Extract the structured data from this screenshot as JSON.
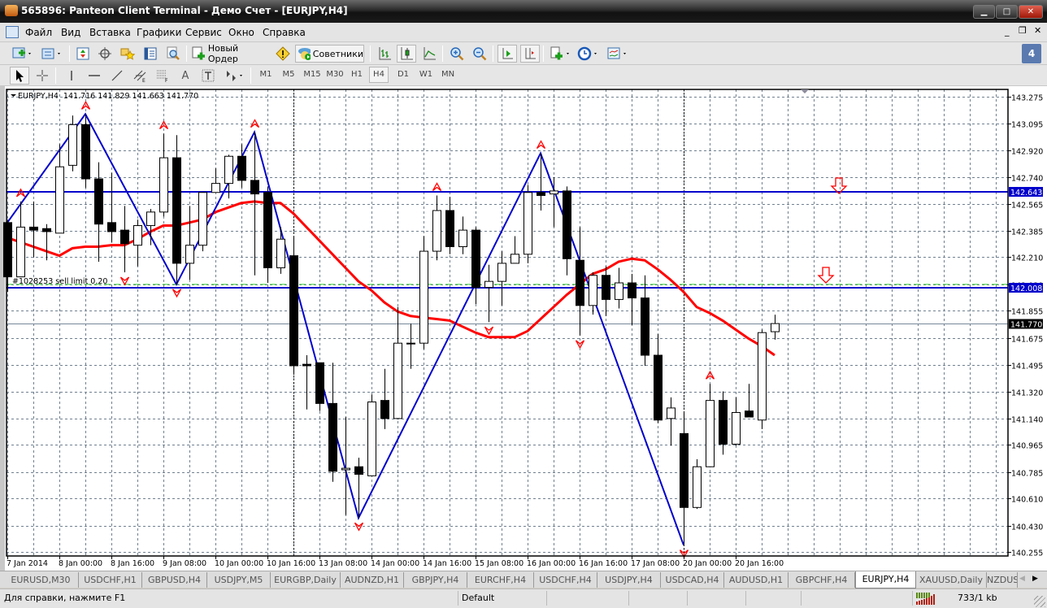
{
  "window": {
    "title": "565896: Panteon Client Terminal - Демо Счет - [EURJPY,H4]"
  },
  "menu": {
    "items": [
      "Файл",
      "Вид",
      "Вставка",
      "Графики",
      "Сервис",
      "Окно",
      "Справка"
    ]
  },
  "toolbar": {
    "new_order_label": "Новый Ордер",
    "experts_label": "Советники",
    "notifications_count": "4",
    "timeframes": [
      "M1",
      "M5",
      "M15",
      "M30",
      "H1",
      "H4",
      "D1",
      "W1",
      "MN"
    ],
    "active_timeframe": "H4"
  },
  "chart": {
    "header": "EURJPY,H4  141.716 141.829 141.663 141.770",
    "order_label": "#1028253 sell limit 0.20",
    "colors": {
      "bull": "#ffffff",
      "bear": "#000000",
      "ma": "#ff0000",
      "zigzag": "#0000cc",
      "level": "#0000cc",
      "order": "#33cc33",
      "grid": "#708090",
      "fractal": "#ff0000"
    }
  },
  "chart_data": {
    "type": "candlestick",
    "symbol": "EURJPY",
    "timeframe": "H4",
    "ylim": [
      140.255,
      143.275
    ],
    "price_ticks": [
      "143.275",
      "143.095",
      "142.920",
      "142.740",
      "142.565",
      "142.385",
      "142.210",
      "142.030",
      "141.855",
      "141.675",
      "141.495",
      "141.320",
      "141.140",
      "140.965",
      "140.785",
      "140.610",
      "140.430",
      "140.255"
    ],
    "time_labels": [
      {
        "bar": 0,
        "label": "7 Jan 2014"
      },
      {
        "bar": 4,
        "label": "8 Jan 00:00"
      },
      {
        "bar": 8,
        "label": "8 Jan 16:00"
      },
      {
        "bar": 12,
        "label": "9 Jan 08:00"
      },
      {
        "bar": 16,
        "label": "10 Jan 00:00"
      },
      {
        "bar": 20,
        "label": "10 Jan 16:00"
      },
      {
        "bar": 24,
        "label": "13 Jan 08:00"
      },
      {
        "bar": 28,
        "label": "14 Jan 00:00"
      },
      {
        "bar": 32,
        "label": "14 Jan 16:00"
      },
      {
        "bar": 36,
        "label": "15 Jan 08:00"
      },
      {
        "bar": 40,
        "label": "16 Jan 00:00"
      },
      {
        "bar": 44,
        "label": "16 Jan 16:00"
      },
      {
        "bar": 48,
        "label": "17 Jan 08:00"
      },
      {
        "bar": 52,
        "label": "20 Jan 00:00"
      },
      {
        "bar": 56,
        "label": "20 Jan 16:00"
      }
    ],
    "ohlc": [
      [
        142.44,
        142.46,
        141.98,
        142.08
      ],
      [
        142.08,
        142.58,
        142.08,
        142.41
      ],
      [
        142.41,
        142.58,
        142.21,
        142.39
      ],
      [
        142.4,
        142.43,
        142.19,
        142.38
      ],
      [
        142.37,
        142.96,
        142.37,
        142.81
      ],
      [
        142.82,
        143.15,
        142.78,
        143.09
      ],
      [
        143.09,
        143.16,
        142.67,
        142.73
      ],
      [
        142.73,
        142.84,
        142.18,
        142.43
      ],
      [
        142.44,
        142.77,
        142.31,
        142.38
      ],
      [
        142.39,
        142.55,
        142.11,
        142.3
      ],
      [
        142.29,
        142.46,
        142.15,
        142.42
      ],
      [
        142.42,
        142.53,
        142.29,
        142.51
      ],
      [
        142.51,
        143.03,
        142.48,
        142.87
      ],
      [
        142.87,
        143.02,
        142.03,
        142.17
      ],
      [
        142.17,
        142.55,
        142.06,
        142.29
      ],
      [
        142.29,
        142.64,
        142.25,
        142.64
      ],
      [
        142.64,
        142.8,
        142.64,
        142.7
      ],
      [
        142.7,
        142.89,
        142.6,
        142.88
      ],
      [
        142.88,
        142.96,
        142.67,
        142.72
      ],
      [
        142.72,
        143.04,
        142.09,
        142.63
      ],
      [
        142.64,
        142.68,
        142.04,
        142.14
      ],
      [
        142.14,
        142.41,
        142.1,
        142.33
      ],
      [
        142.22,
        142.35,
        141.43,
        141.49
      ],
      [
        141.5,
        141.56,
        141.2,
        141.49
      ],
      [
        141.51,
        141.51,
        141.19,
        141.24
      ],
      [
        141.24,
        141.51,
        140.72,
        140.79
      ],
      [
        140.8,
        141.15,
        140.5,
        140.81
      ],
      [
        140.82,
        140.88,
        140.48,
        140.77
      ],
      [
        140.76,
        141.3,
        140.76,
        141.25
      ],
      [
        141.26,
        141.47,
        141.07,
        141.14
      ],
      [
        141.14,
        141.88,
        141.14,
        141.64
      ],
      [
        141.64,
        141.77,
        141.47,
        141.64
      ],
      [
        141.64,
        142.35,
        141.6,
        142.25
      ],
      [
        142.25,
        142.62,
        142.19,
        142.52
      ],
      [
        142.52,
        142.61,
        142.23,
        142.28
      ],
      [
        142.28,
        142.48,
        142.23,
        142.39
      ],
      [
        142.39,
        142.41,
        141.9,
        142.01
      ],
      [
        142.01,
        142.16,
        141.78,
        142.05
      ],
      [
        142.05,
        142.25,
        141.89,
        142.17
      ],
      [
        142.17,
        142.35,
        142.17,
        142.23
      ],
      [
        142.23,
        142.69,
        142.17,
        142.64
      ],
      [
        142.64,
        142.9,
        142.52,
        142.62
      ],
      [
        142.63,
        142.74,
        142.41,
        142.65
      ],
      [
        142.65,
        142.68,
        142.09,
        142.2
      ],
      [
        142.19,
        142.41,
        141.69,
        141.89
      ],
      [
        141.89,
        142.11,
        141.83,
        142.09
      ],
      [
        142.09,
        142.15,
        141.82,
        141.93
      ],
      [
        141.93,
        142.14,
        141.87,
        142.04
      ],
      [
        142.04,
        142.1,
        141.76,
        141.94
      ],
      [
        141.94,
        142.09,
        141.49,
        141.56
      ],
      [
        141.56,
        141.7,
        141.11,
        141.13
      ],
      [
        141.14,
        141.28,
        140.96,
        141.21
      ],
      [
        141.04,
        141.18,
        140.3,
        140.55
      ],
      [
        140.55,
        140.87,
        140.54,
        140.82
      ],
      [
        140.82,
        141.37,
        140.82,
        141.26
      ],
      [
        141.26,
        141.32,
        140.9,
        140.97
      ],
      [
        140.97,
        141.28,
        140.96,
        141.18
      ],
      [
        141.19,
        141.37,
        141.15,
        141.15
      ],
      [
        141.13,
        141.73,
        141.07,
        141.71
      ],
      [
        141.716,
        141.829,
        141.663,
        141.77
      ]
    ],
    "ma": [
      142.34,
      142.31,
      142.28,
      142.25,
      142.22,
      142.27,
      142.28,
      142.28,
      142.29,
      142.29,
      142.33,
      142.38,
      142.42,
      142.42,
      142.44,
      142.46,
      142.51,
      142.54,
      142.57,
      142.58,
      142.57,
      142.57,
      142.5,
      142.41,
      142.32,
      142.23,
      142.14,
      142.05,
      141.99,
      141.91,
      141.85,
      141.82,
      141.81,
      141.8,
      141.79,
      141.75,
      141.71,
      141.68,
      141.68,
      141.68,
      141.72,
      141.8,
      141.88,
      141.96,
      142.03,
      142.1,
      142.13,
      142.18,
      142.2,
      142.19,
      142.13,
      142.06,
      141.98,
      141.88,
      141.84,
      141.79,
      141.73,
      141.67,
      141.62,
      141.56
    ],
    "zigzag": [
      [
        0,
        142.44
      ],
      [
        6,
        143.16
      ],
      [
        13,
        142.03
      ],
      [
        19,
        143.04
      ],
      [
        27,
        140.48
      ],
      [
        41,
        142.9
      ],
      [
        52,
        140.3
      ]
    ],
    "fractals_up": [
      1,
      6,
      12,
      19,
      33,
      41,
      54
    ],
    "fractals_down": [
      9,
      13,
      27,
      37,
      44,
      52
    ],
    "levels": [
      {
        "price": 142.643,
        "label": "142.643",
        "kind": "line"
      },
      {
        "price": 142.008,
        "label": "142.008",
        "kind": "line"
      }
    ],
    "order_price": 142.03,
    "current_price": {
      "price": 141.77,
      "label": "141.770"
    },
    "separators": [
      22,
      52
    ]
  },
  "tabs": [
    "EURUSD,M30",
    "USDCHF,H1",
    "GBPUSD,H4",
    "USDJPY,M5",
    "EURGBP,Daily",
    "AUDNZD,H1",
    "GBPJPY,H4",
    "EURCHF,H4",
    "USDCHF,H4",
    "USDJPY,H4",
    "USDCAD,H4",
    "AUDUSD,H1",
    "GBPCHF,H4",
    "EURJPY,H4",
    "XAUUSD,Daily",
    "NZDUSD"
  ],
  "active_tab": "EURJPY,H4",
  "status": {
    "help": "Для справки, нажмите F1",
    "profile": "Default",
    "traffic": "733/1 kb"
  }
}
